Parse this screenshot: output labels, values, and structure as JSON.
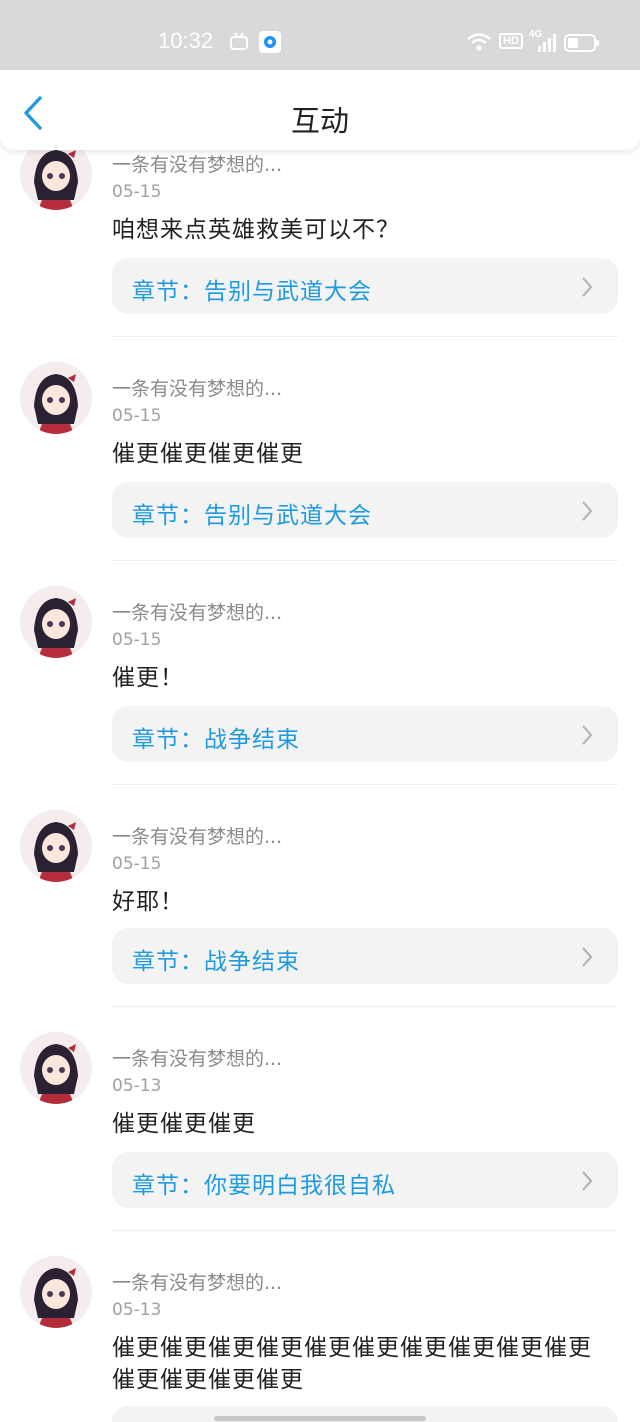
{
  "status_bar": {
    "time": "10:32",
    "network": "4G",
    "hd": "HD"
  },
  "header": {
    "title": "互动",
    "back_icon": "chevron-left-icon",
    "accent_color": "#1e9be0"
  },
  "chapter_prefix": "章节：",
  "items": [
    {
      "username": "一条有没有梦想的...",
      "date": "05-15",
      "comment": "咱想来点英雄救美可以不？",
      "chapter": "章节：告别与武道大会"
    },
    {
      "username": "一条有没有梦想的...",
      "date": "05-15",
      "comment": "催更催更催更催更",
      "chapter": "章节：告别与武道大会"
    },
    {
      "username": "一条有没有梦想的...",
      "date": "05-15",
      "comment": "催更！",
      "chapter": "章节：战争结束"
    },
    {
      "username": "一条有没有梦想的...",
      "date": "05-15",
      "comment": "好耶！",
      "chapter": "章节：战争结束"
    },
    {
      "username": "一条有没有梦想的...",
      "date": "05-13",
      "comment": "催更催更催更",
      "chapter": "章节：你要明白我很自私"
    },
    {
      "username": "一条有没有梦想的...",
      "date": "05-13",
      "comment": "催更催更催更催更催更催更催更催更催更催更催更催更催更催更",
      "chapter": ""
    }
  ]
}
